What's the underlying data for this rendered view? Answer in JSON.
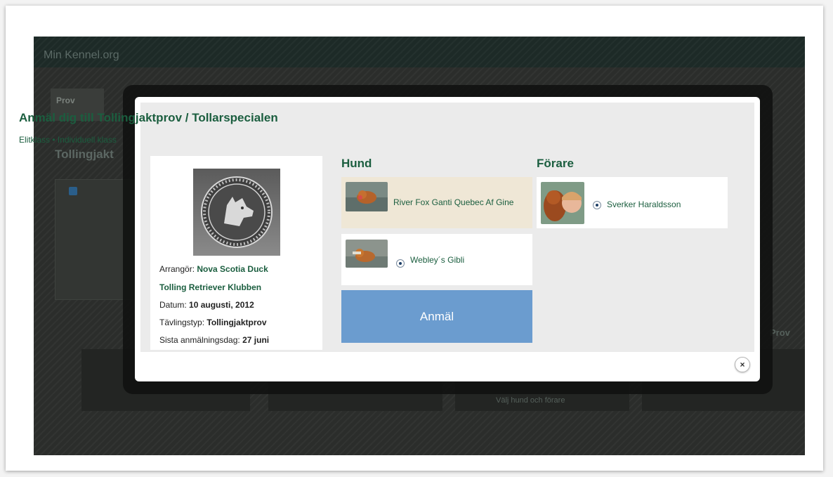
{
  "background": {
    "brand": "Min Kennel.org",
    "tab_label": "Prov",
    "page_title": "Tollingjakt",
    "dark_button_label": "Välj hund och förare",
    "right_title": "Prov"
  },
  "modal": {
    "title": "Anmäl dig till Tollingjaktprov / Tollarspecialen",
    "classes": "Elitklass • Individuell klass",
    "info": {
      "organizer_label": "Arrangör:",
      "organizer_value_line1": "Nova Scotia Duck",
      "organizer_value_line2": "Tolling Retriever Klubben",
      "date_label": "Datum:",
      "date_value": "10 augusti, 2012",
      "type_label": "Tävlingstyp:",
      "type_value": "Tollingjaktprov",
      "deadline_label": "Sista anmälningsdag:",
      "deadline_value": "27 juni"
    },
    "hund_header": "Hund",
    "forare_header": "Förare",
    "dogs": [
      {
        "name": "River Fox Ganti Quebec Af Gine",
        "selected": true
      },
      {
        "name": "Webley´s Gibli",
        "selected": false
      }
    ],
    "handlers": [
      {
        "name": "Sverker Haraldsson"
      }
    ],
    "submit_label": "Anmäl",
    "close_glyph": "×"
  },
  "colors": {
    "accent_green": "#1b5e3f",
    "submit_blue": "#6b9ccf",
    "selected_card": "#efe7d6"
  }
}
